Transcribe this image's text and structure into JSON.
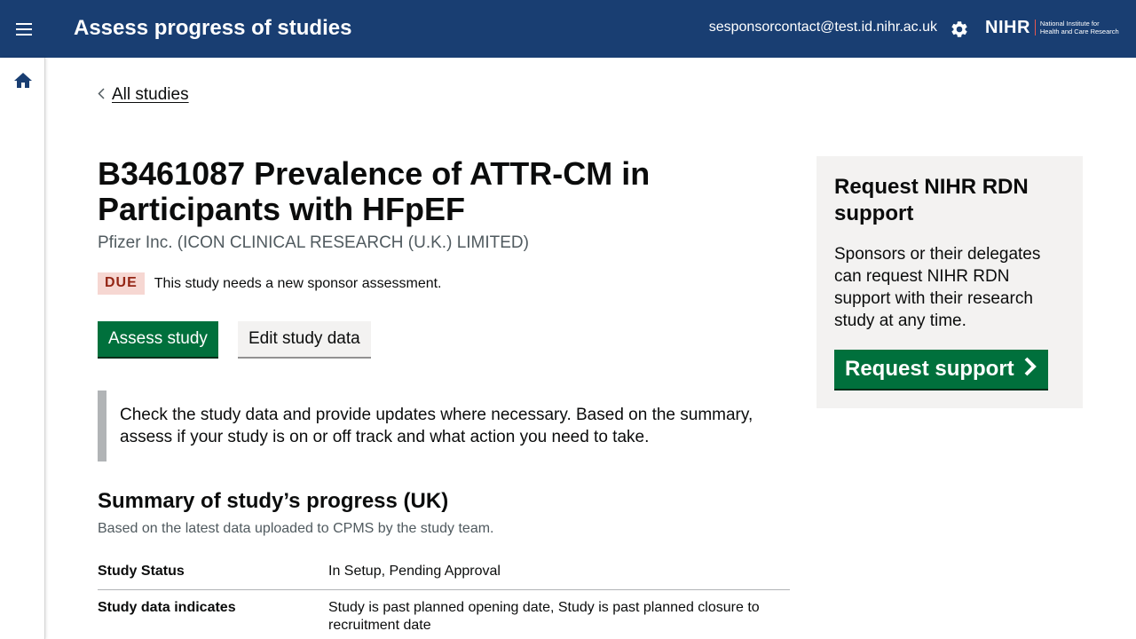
{
  "header": {
    "app_title": "Assess progress of studies",
    "user_email": "sesponsorcontact@test.id.nihr.ac.uk",
    "logo_word": "NIHR",
    "logo_sub_line1": "National Institute for",
    "logo_sub_line2": "Health and Care Research",
    "icons": [
      "menu-icon",
      "gear-icon"
    ],
    "bg_color": "#193e72"
  },
  "sidenav": {
    "icons": [
      "home-icon"
    ]
  },
  "breadcrumb": {
    "back_label": "All studies"
  },
  "study": {
    "title": "B3461087 Prevalence of ATTR-CM in Participants with HFpEF",
    "sponsor": "Pfizer Inc. (ICON CLINICAL RESEARCH (U.K.) LIMITED)",
    "status_tag": "DUE",
    "status_text": "This study needs a new sponsor assessment."
  },
  "actions": {
    "assess_label": "Assess study",
    "edit_label": "Edit study data"
  },
  "inset_text": "Check the study data and provide updates where necessary. Based on the summary, assess if your study is on or off track and what action you need to take.",
  "summary": {
    "heading": "Summary of study’s progress (UK)",
    "subheading": "Based on the latest data uploaded to CPMS by the study team.",
    "rows": [
      {
        "key": "Study Status",
        "value": "In Setup, Pending Approval"
      },
      {
        "key": "Study data indicates",
        "value": "Study is past planned opening date, Study is past planned closure to recruitment date"
      }
    ]
  },
  "aside": {
    "title": "Request NIHR RDN support",
    "text": "Sponsors or their delegates can request NIHR RDN support with their research study at any time.",
    "button_label": "Request support"
  },
  "colors": {
    "primary_green": "#00703c",
    "due_bg": "#f6d7d2",
    "due_fg": "#942514"
  }
}
